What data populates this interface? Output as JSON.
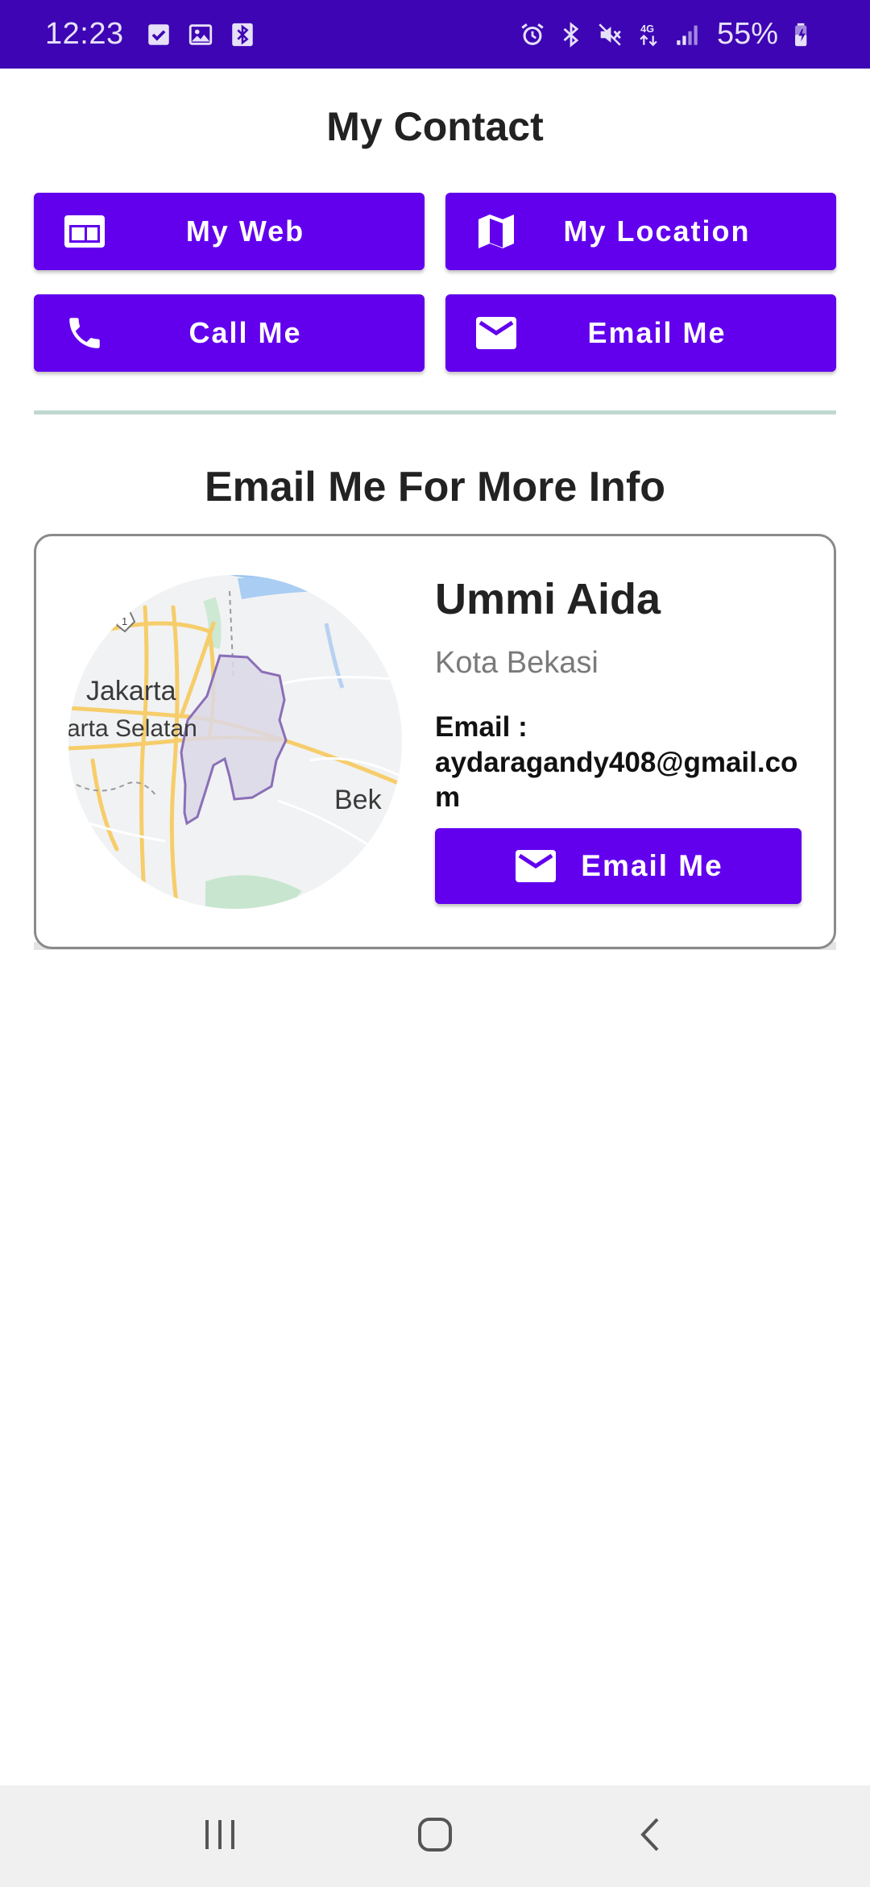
{
  "status_bar": {
    "time": "12:23",
    "battery": "55%",
    "left_icons": [
      "checkbox-notification-icon",
      "image-notification-icon",
      "bluetooth-notification-icon"
    ],
    "right_icons": [
      "alarm-icon",
      "bluetooth-icon",
      "mute-icon",
      "4g-data-icon",
      "signal-icon",
      "battery-charging-icon"
    ]
  },
  "header": {
    "title": "My Contact"
  },
  "actions": {
    "web": {
      "label": "My Web",
      "icon": "web-icon"
    },
    "location": {
      "label": "My Location",
      "icon": "map-icon"
    },
    "call": {
      "label": "Call Me",
      "icon": "phone-icon"
    },
    "email": {
      "label": "Email Me",
      "icon": "mail-icon"
    }
  },
  "section": {
    "title": "Email Me For More Info"
  },
  "card": {
    "name": "Ummi Aida",
    "city": "Kota Bekasi",
    "email_label": "Email :",
    "email": "aydaragandy408@gmail.com",
    "button_label": "Email Me",
    "map_labels": {
      "city1": "Jakarta",
      "district": "arta Selatan",
      "city2": "Bek",
      "route": "1"
    }
  },
  "nav_bar": {
    "items": [
      "recent-apps-icon",
      "home-icon",
      "back-icon"
    ]
  },
  "colors": {
    "status_bar": "#3d05b3",
    "accent": "#6200ee",
    "divider": "#bfd9d0"
  }
}
